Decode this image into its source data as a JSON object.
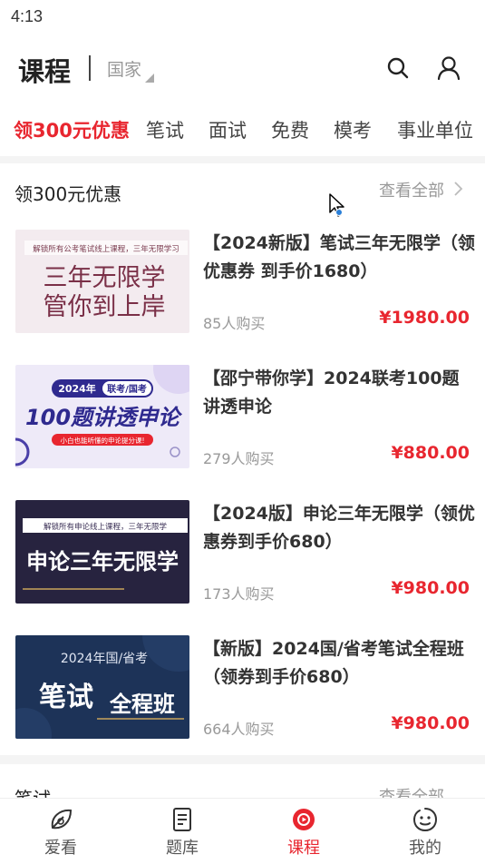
{
  "status_bar": {
    "time": "4:13"
  },
  "header": {
    "title": "课程",
    "region": "国家",
    "search_icon": "search-icon",
    "user_icon": "user-icon"
  },
  "tabs": [
    {
      "label": "领300元优惠",
      "active": true
    },
    {
      "label": "笔试"
    },
    {
      "label": "面试"
    },
    {
      "label": "免费"
    },
    {
      "label": "模考"
    },
    {
      "label": "事业单位"
    }
  ],
  "section": {
    "title": "领300元优惠",
    "view_all": "查看全部"
  },
  "courses": [
    {
      "title": "【2024新版】笔试三年无限学（领优惠券 到手价1680）",
      "sold": "85人购买",
      "price": "¥1980.00",
      "thumb": {
        "top_text": "解锁所有公考笔试线上课程，三年无限学习",
        "line1": "三年无限学",
        "line2": "管你到上岸"
      }
    },
    {
      "title": "【邵宁带你学】2024联考100题讲透申论",
      "sold": "279人购买",
      "price": "¥880.00",
      "thumb": {
        "badge_year": "2024年",
        "badge_exam": "联考/国考",
        "main": "100题讲透申论",
        "sub": "小白也能听懂的申论提分课!"
      }
    },
    {
      "title": "【2024版】申论三年无限学（领优惠券到手价680）",
      "sold": "173人购买",
      "price": "¥980.00",
      "thumb": {
        "top_text": "解锁所有申论线上课程，三年无限学",
        "main": "申论三年无限学"
      }
    },
    {
      "title": "【新版】2024国/省考笔试全程班（领券到手价680）",
      "sold": "664人购买",
      "price": "¥980.00",
      "thumb": {
        "top_text": "2024年国/省考",
        "main1": "笔试",
        "main2": "全程班"
      }
    }
  ],
  "next_section": {
    "title": "笔试",
    "view_all": "查看全部"
  },
  "bottom_nav": [
    {
      "label": "爱看",
      "icon": "leaf-icon"
    },
    {
      "label": "题库",
      "icon": "question-bank-icon"
    },
    {
      "label": "课程",
      "icon": "play-icon",
      "active": true
    },
    {
      "label": "我的",
      "icon": "smiley-icon"
    }
  ],
  "colors": {
    "accent": "#e8262f",
    "muted": "#999999"
  }
}
